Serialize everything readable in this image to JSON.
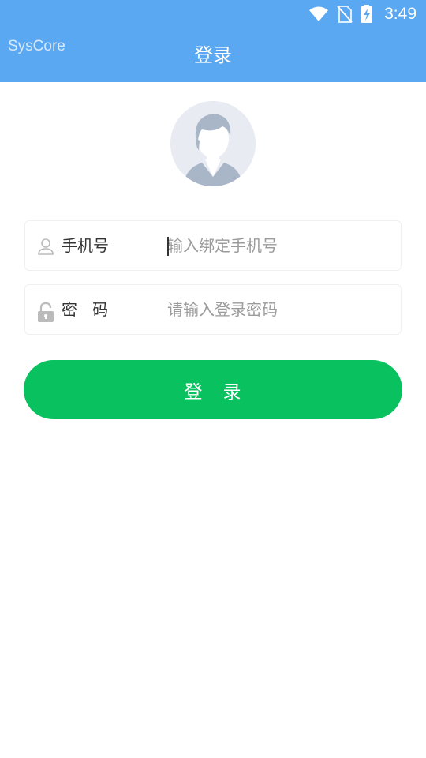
{
  "status_bar": {
    "time": "3:49",
    "icons": [
      "wifi-icon",
      "no-sim-icon",
      "battery-charging-icon"
    ]
  },
  "header": {
    "app_name": "SysCore",
    "title": "登录"
  },
  "avatar": {
    "icon": "default-user-avatar-icon"
  },
  "form": {
    "phone": {
      "label": "手机号",
      "placeholder": "输入绑定手机号",
      "value": "",
      "icon": "user-icon"
    },
    "password": {
      "label": "密   码",
      "placeholder": "请输入登录密码",
      "value": "",
      "icon": "lock-open-icon"
    },
    "submit_label": "登   录"
  },
  "colors": {
    "header_bg": "#5ba8f2",
    "button_bg": "#0ac160",
    "placeholder": "#9b9b9b"
  }
}
